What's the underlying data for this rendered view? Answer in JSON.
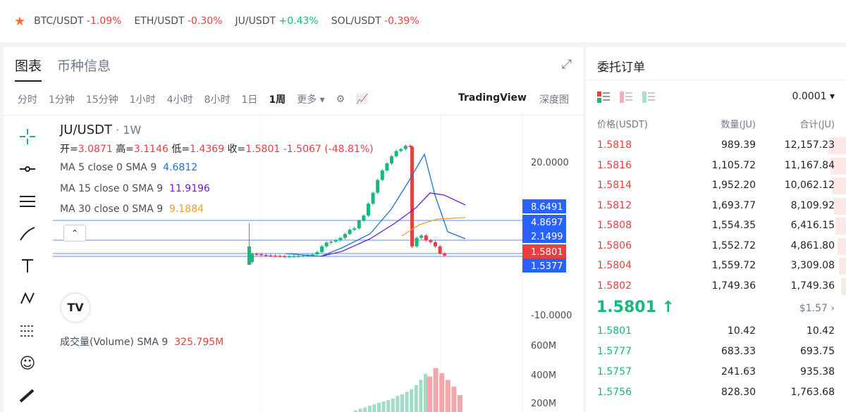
{
  "ticker": {
    "items": [
      {
        "symbol": "BTC/USDT",
        "change": "-1.09%",
        "up": false
      },
      {
        "symbol": "ETH/USDT",
        "change": "-0.30%",
        "up": false
      },
      {
        "symbol": "JU/USDT",
        "change": "+0.43%",
        "up": true
      },
      {
        "symbol": "SOL/USDT",
        "change": "-0.39%",
        "up": false
      }
    ]
  },
  "chart_panel": {
    "tabs": [
      "图表",
      "币种信息"
    ],
    "timeframes": [
      "分时",
      "1分钟",
      "15分钟",
      "1小时",
      "4小时",
      "8小时",
      "1日",
      "1周"
    ],
    "selected_timeframe": "1周",
    "more": "更多",
    "view_tradingview": "TradingView",
    "view_depth": "深度图",
    "pair": "JU/USDT",
    "interval": "1W",
    "ohlc": {
      "open": "3.0871",
      "high": "3.1146",
      "low": "1.4369",
      "close": "1.5801",
      "change": "-1.5067",
      "change_pct": "(-48.81%)"
    },
    "ohlc_labels": {
      "open": "开=",
      "high": "高=",
      "low": "低=",
      "close": "收="
    },
    "ma": [
      {
        "label": "MA 5 close 0 SMA 9",
        "value": "4.6812",
        "color": "#1976d2"
      },
      {
        "label": "MA 15 close 0 SMA 9",
        "value": "11.9196",
        "color": "#6a1fd6"
      },
      {
        "label": "MA 30 close 0 SMA 9",
        "value": "9.1884",
        "color": "#f0a020"
      }
    ],
    "volume": {
      "label": "成交量(Volume) SMA 9",
      "value": "325.795M"
    },
    "axis_labels": [
      "20.0000",
      "-10.0000",
      "600M",
      "400M",
      "200M"
    ],
    "price_tags": [
      {
        "value": "8.6491",
        "color": "#2962ff"
      },
      {
        "value": "4.8697",
        "color": "#2962ff"
      },
      {
        "value": "2.1499",
        "color": "#2962ff"
      },
      {
        "value": "1.5801",
        "color": "#e8403f"
      },
      {
        "value": "1.5377",
        "color": "#2962ff"
      }
    ],
    "chart_data": {
      "type": "candlestick",
      "series": [
        {
          "name": "JU/USDT 1W",
          "closes": [
            0.2,
            1.9,
            1.85,
            1.7,
            1.6,
            1.55,
            1.5,
            1.45,
            1.4,
            1.42,
            1.45,
            1.5,
            1.55,
            1.6,
            1.8,
            2.3,
            3.5,
            4.3,
            4.5,
            4.8,
            5.3,
            6.1,
            7.0,
            7.3,
            8.9,
            10.0,
            12.5,
            14.8,
            17.5,
            19.5,
            21.0,
            22.5,
            23.6,
            24.0,
            24.7,
            24.5,
            3.5,
            5.3,
            5.8,
            4.8,
            4.4,
            3.5,
            2.0,
            1.58
          ]
        },
        {
          "name": "MA 5",
          "values": []
        },
        {
          "name": "MA 15",
          "values": []
        },
        {
          "name": "MA 30",
          "values": []
        }
      ],
      "volume_green": [
        20,
        40,
        55,
        75,
        90,
        110,
        125,
        140,
        160,
        190,
        210,
        240,
        270,
        320,
        380,
        450
      ],
      "volume_red": [
        420,
        520,
        460,
        380,
        300,
        200
      ]
    }
  },
  "orderbook": {
    "title": "委托订单",
    "precision": "0.0001",
    "headers": {
      "price": "价格(USDT)",
      "amount": "数量(JU)",
      "total": "合计(JU)"
    },
    "asks": [
      {
        "price": "1.5818",
        "amount": "989.39",
        "total": "12,157.23",
        "depth": 0.1
      },
      {
        "price": "1.5816",
        "amount": "1,105.72",
        "total": "11,167.84",
        "depth": 0.09
      },
      {
        "price": "1.5814",
        "amount": "1,952.20",
        "total": "10,062.12",
        "depth": 0.08
      },
      {
        "price": "1.5812",
        "amount": "1,693.77",
        "total": "8,109.92",
        "depth": 0.07
      },
      {
        "price": "1.5808",
        "amount": "1,554.35",
        "total": "6,416.15",
        "depth": 0.06
      },
      {
        "price": "1.5806",
        "amount": "1,552.72",
        "total": "4,861.80",
        "depth": 0.05
      },
      {
        "price": "1.5804",
        "amount": "1,559.72",
        "total": "3,309.08",
        "depth": 0.04
      },
      {
        "price": "1.5802",
        "amount": "1,749.36",
        "total": "1,749.36",
        "depth": 0.03
      }
    ],
    "last_price": "1.5801 ↑",
    "last_price_usd": "$1.57",
    "bids": [
      {
        "price": "1.5801",
        "amount": "10.42",
        "total": "10.42"
      },
      {
        "price": "1.5777",
        "amount": "683.33",
        "total": "693.75"
      },
      {
        "price": "1.5757",
        "amount": "241.63",
        "total": "935.38"
      },
      {
        "price": "1.5756",
        "amount": "828.30",
        "total": "1,763.68"
      }
    ]
  }
}
